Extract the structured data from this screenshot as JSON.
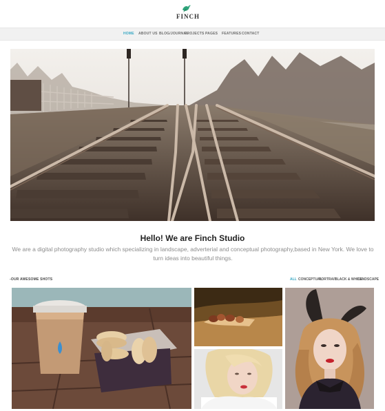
{
  "brand": {
    "name": "FINCH"
  },
  "nav": [
    {
      "label": "HOME",
      "active": true
    },
    {
      "label": "ABOUT US"
    },
    {
      "label": "BLOG/JOURNAL"
    },
    {
      "label": "PROJECTS"
    },
    {
      "label": "PAGES"
    },
    {
      "label": "FEATURES"
    },
    {
      "label": "CONTACT"
    }
  ],
  "intro": {
    "headline": "Hello! We are Finch Studio",
    "text": "We are a digital photography studio which specializing in landscape, adverterial and conceptual photography,based in New York. We love to turn ideas into beautiful things."
  },
  "shots": {
    "title": "-OUR AWESOME SHOTS",
    "filters": [
      "ALL",
      "CONCEPTUAL",
      "PORTRAIT",
      "BLACK & WHITE",
      "LANDSCAPE"
    ],
    "active_filter": "ALL"
  },
  "colors": {
    "accent": "#37a7c3",
    "logo_bird": "#2ea37a"
  }
}
